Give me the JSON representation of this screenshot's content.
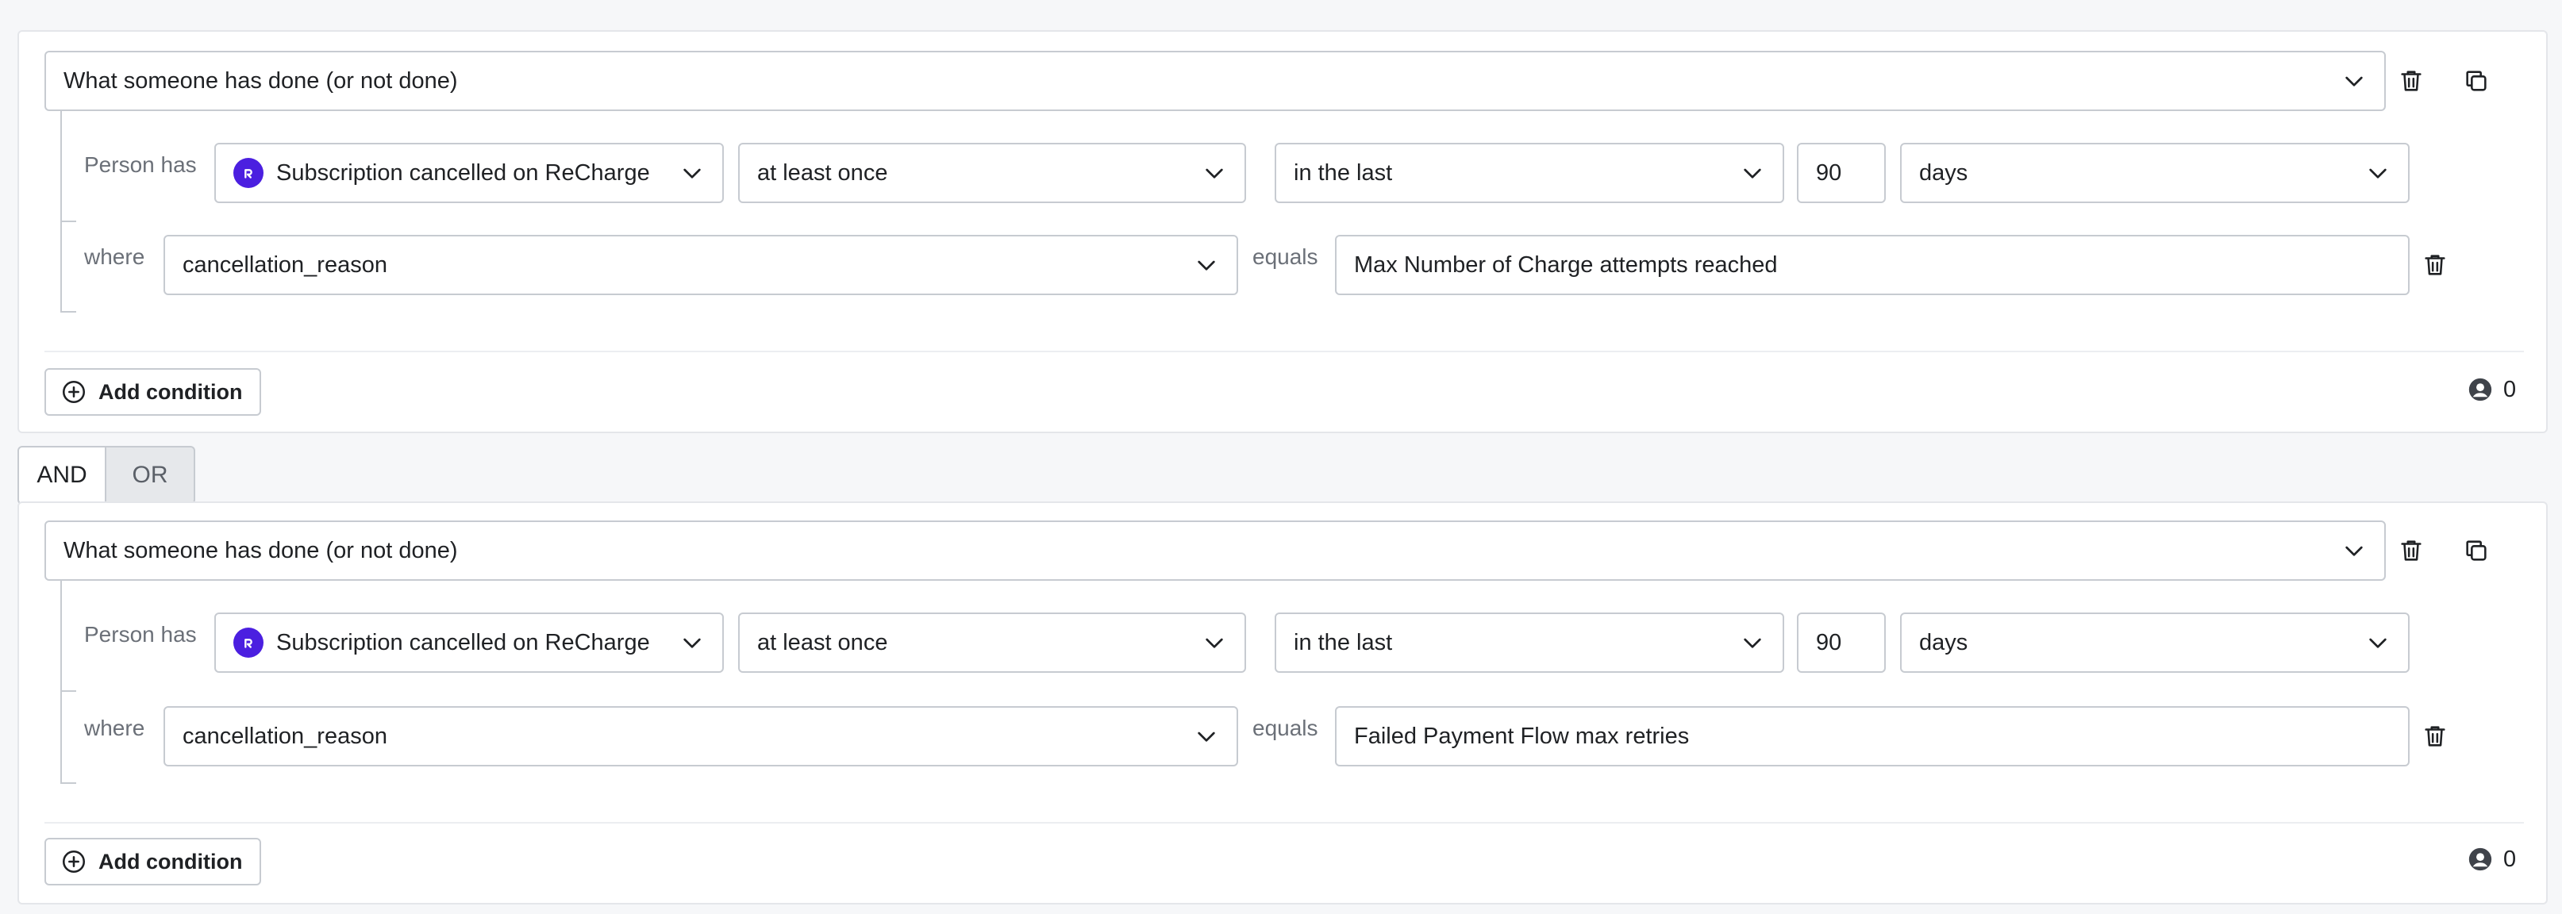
{
  "groups": [
    {
      "type_select": "What someone has done (or not done)",
      "person_has_label": "Person has",
      "metric": "Subscription cancelled on ReCharge",
      "metric_icon": "recharge-logo-icon",
      "frequency": "at least once",
      "timeframe": "in the last",
      "time_value": "90",
      "time_unit": "days",
      "where_label": "where",
      "property": "cancellation_reason",
      "operator_label": "equals",
      "value": "Max Number of Charge attempts reached",
      "add_condition_label": "Add condition",
      "count": "0"
    },
    {
      "type_select": "What someone has done (or not done)",
      "person_has_label": "Person has",
      "metric": "Subscription cancelled on ReCharge",
      "metric_icon": "recharge-logo-icon",
      "frequency": "at least once",
      "timeframe": "in the last",
      "time_value": "90",
      "time_unit": "days",
      "where_label": "where",
      "property": "cancellation_reason",
      "operator_label": "equals",
      "value": "Failed Payment Flow max retries",
      "add_condition_label": "Add condition",
      "count": "0"
    }
  ],
  "logic_toggle": {
    "and_label": "AND",
    "or_label": "OR",
    "selected": "AND"
  },
  "colors": {
    "recharge_brand": "#4b1fe0",
    "border": "#c7cbd1",
    "background": "#f6f7f9"
  }
}
